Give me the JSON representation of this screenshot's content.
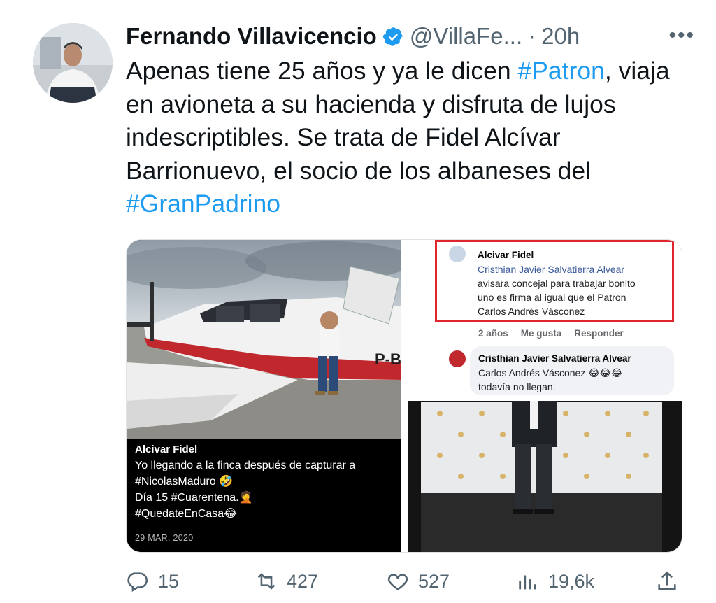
{
  "tweet": {
    "author_name": "Fernando Villavicencio",
    "handle": "@VillaFe...",
    "separator": "·",
    "time": "20h",
    "more": "•••",
    "text_segments": [
      {
        "text": "Apenas tiene 25 años y ya le dicen ",
        "tag": false
      },
      {
        "text": "#Patron",
        "tag": true
      },
      {
        "text": ", viaja en avioneta a su hacienda y disfruta de lujos indescriptibles. Se trata de Fidel Alcívar Barrionuevo, el socio de los albaneses del ",
        "tag": false
      },
      {
        "text": "#GranPadrino",
        "tag": true
      }
    ]
  },
  "media": {
    "left_caption": {
      "author": "Alcivar Fidel",
      "line1": "Yo llegando a la finca después de capturar a",
      "line2": "#NicolasMaduro 🤣",
      "line3": "Día 15 #Cuarentena.🤦",
      "line4": "#QuedateEnCasa😂",
      "date": "29 MAR. 2020"
    },
    "plane_registration": "P-BI",
    "right_top": {
      "comment1": {
        "name": "Alcivar Fidel",
        "mention": "Cristhian Javier Salvatierra Alvear",
        "line1": "avisara concejal para trabajar bonito",
        "line2": "uno es firma al igual que el Patron",
        "line3": "Carlos Andrés Vásconez"
      },
      "meta": {
        "age": "2 años",
        "like": "Me gusta",
        "reply": "Responder"
      },
      "comment2": {
        "name": "Cristhian Javier Salvatierra Alvear",
        "line1": "Carlos Andrés Vásconez 😂😂😂",
        "line2": "todavía no llegan."
      }
    }
  },
  "actions": {
    "replies": "15",
    "retweets": "427",
    "likes": "527",
    "views": "19,6k"
  },
  "colors": {
    "accent": "#1d9bf0",
    "muted": "#536471",
    "highlight_box": "#e0262c"
  }
}
